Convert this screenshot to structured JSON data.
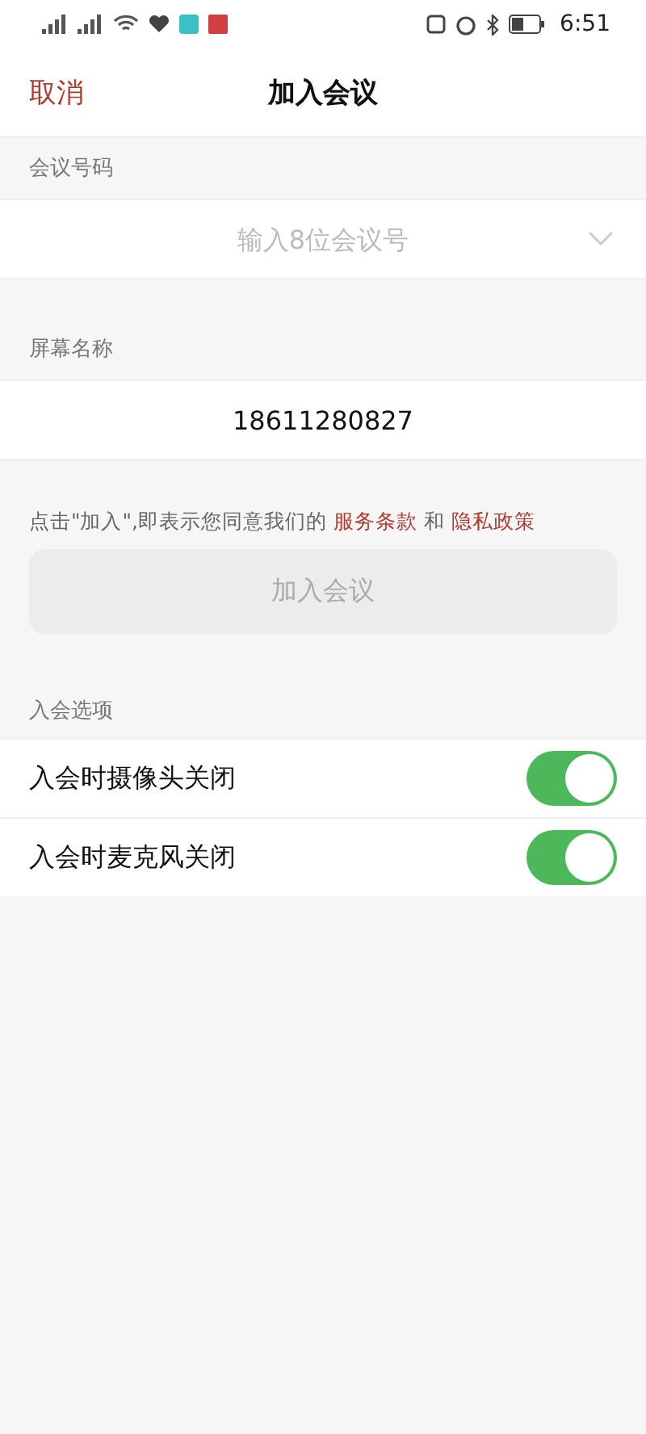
{
  "status_bar": {
    "time": "6:51"
  },
  "nav": {
    "cancel": "取消",
    "title": "加入会议"
  },
  "meeting_number": {
    "label": "会议号码",
    "placeholder": "输入8位会议号"
  },
  "screen_name": {
    "label": "屏幕名称",
    "value": "18611280827"
  },
  "agreement": {
    "text": "点击\"加入\",即表示您同意我们的",
    "terms_link": "服务条款",
    "and": "和",
    "privacy_link": "隐私政策"
  },
  "join_button": {
    "label": "加入会议",
    "disabled": true
  },
  "options": {
    "label": "入会选项",
    "items": [
      {
        "label": "入会时摄像头关闭",
        "on": true
      },
      {
        "label": "入会时麦克风关闭",
        "on": true
      }
    ]
  }
}
